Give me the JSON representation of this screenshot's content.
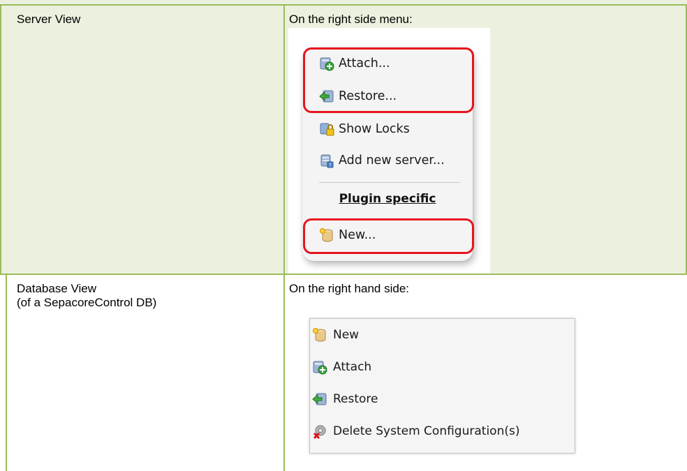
{
  "rows": [
    {
      "view_label": [
        "Server View"
      ],
      "location_text": "On the right side menu:",
      "menu": {
        "items": [
          {
            "label": "Attach...",
            "icon": "attach-icon"
          },
          {
            "label": "Restore...",
            "icon": "restore-icon"
          },
          {
            "label": "Show Locks",
            "icon": "locks-icon"
          },
          {
            "label": "Add new server...",
            "icon": "add-server-icon"
          }
        ],
        "section_header": "Plugin specific",
        "plugin_items": [
          {
            "label": "New...",
            "icon": "new-db-icon"
          }
        ],
        "highlight_color": "#e8141d"
      }
    },
    {
      "view_label": [
        "Database View",
        "(of a SepacoreControl DB)"
      ],
      "location_text": "On the right hand side:",
      "menu": {
        "items": [
          {
            "label": "New",
            "icon": "new-db-icon"
          },
          {
            "label": "Attach",
            "icon": "attach-icon"
          },
          {
            "label": "Restore",
            "icon": "restore-icon"
          },
          {
            "label": "Delete System Configuration(s)",
            "icon": "delete-config-icon"
          }
        ]
      }
    }
  ],
  "colors": {
    "grid": "#9bbb59",
    "row_shade": "#ebf1de"
  }
}
